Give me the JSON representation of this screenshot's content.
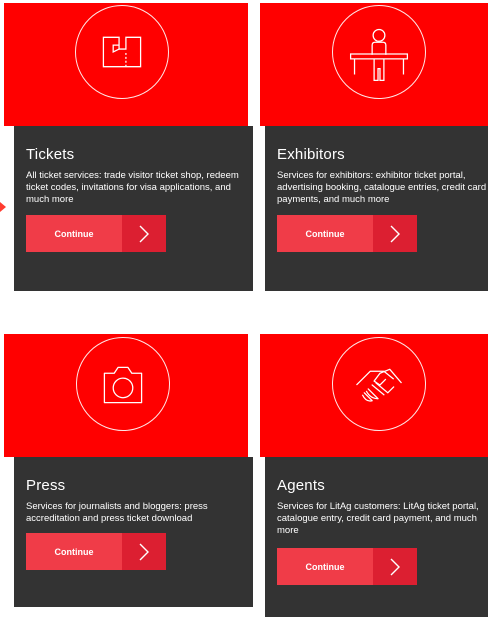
{
  "colors": {
    "hero_red": "#ff0000",
    "panel_dark": "#333333",
    "button_label": "#f03c48",
    "button_arrow": "#dc1f31"
  },
  "cards": [
    {
      "icon": "ticket-icon",
      "title": "Tickets",
      "description": "All ticket services: trade visitor ticket shop, redeem ticket codes, invitations for visa applications, and much more",
      "button_label": "Continue"
    },
    {
      "icon": "exhibitor-icon",
      "title": "Exhibitors",
      "description": "Services for exhibitors: exhibitor ticket portal, advertising booking, catalogue entries, credit card payments, and much more",
      "button_label": "Continue"
    },
    {
      "icon": "camera-icon",
      "title": "Press",
      "description": "Services for journalists and bloggers: press accreditation and press ticket download",
      "button_label": "Continue"
    },
    {
      "icon": "handshake-icon",
      "title": "Agents",
      "description": "Services for LitAg customers: LitAg ticket portal, catalogue entry, credit card payment, and much more",
      "button_label": "Continue"
    }
  ]
}
